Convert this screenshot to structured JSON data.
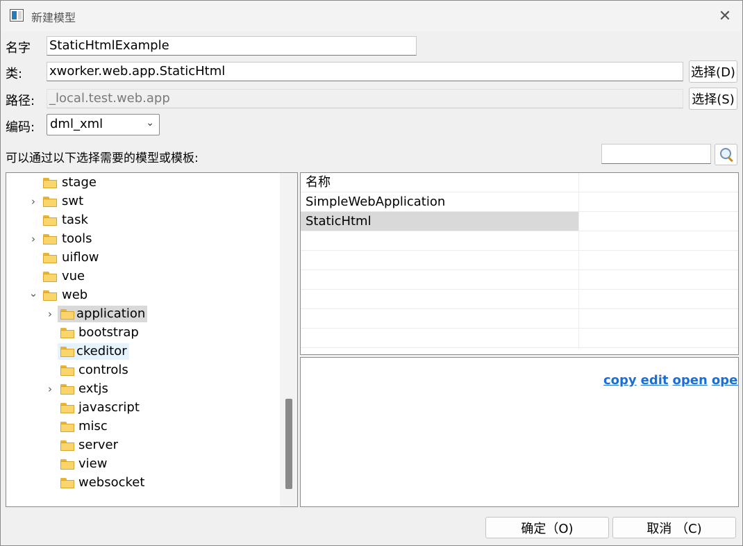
{
  "window": {
    "title": "新建模型"
  },
  "form": {
    "name_label": "名字",
    "name_value": "StaticHtmlExample",
    "class_label": "类:",
    "class_value": "xworker.web.app.StaticHtml",
    "class_button": "选择(D)",
    "path_label": "路径:",
    "path_value": "_local.test.web.app",
    "path_button": "选择(S)",
    "encoding_label": "编码:",
    "encoding_value": "dml_xml",
    "hint": "可以通过以下选择需要的模型或模板:"
  },
  "tree": {
    "items": [
      {
        "label": "stage",
        "expander": ""
      },
      {
        "label": "swt",
        "expander": "›"
      },
      {
        "label": "task",
        "expander": ""
      },
      {
        "label": "tools",
        "expander": "›"
      },
      {
        "label": "uiflow",
        "expander": ""
      },
      {
        "label": "vue",
        "expander": ""
      },
      {
        "label": "web",
        "expander": "⌄"
      },
      {
        "label": "application",
        "expander": "›"
      },
      {
        "label": "bootstrap",
        "expander": ""
      },
      {
        "label": "ckeditor",
        "expander": ""
      },
      {
        "label": "controls",
        "expander": ""
      },
      {
        "label": "extjs",
        "expander": "›"
      },
      {
        "label": "javascript",
        "expander": ""
      },
      {
        "label": "misc",
        "expander": ""
      },
      {
        "label": "server",
        "expander": ""
      },
      {
        "label": "view",
        "expander": ""
      },
      {
        "label": "websocket",
        "expander": ""
      }
    ]
  },
  "table": {
    "header": "名称",
    "rows": [
      "SimpleWebApplication",
      "StaticHtml"
    ]
  },
  "info": {
    "links": [
      "copy",
      "edit",
      "open",
      "openr"
    ]
  },
  "buttons": {
    "ok": "确定（O)",
    "cancel": "取消 （C)"
  },
  "icons": {
    "close": "close-icon",
    "search": "search-icon",
    "folder": "folder-icon"
  }
}
